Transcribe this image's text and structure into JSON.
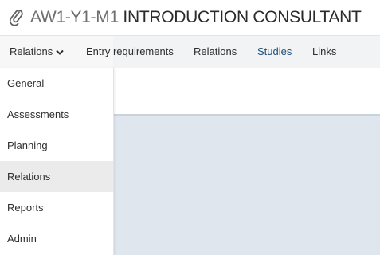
{
  "header": {
    "icon": "paperclip-icon",
    "code": "AW1-Y1-M1",
    "name": "INTRODUCTION CONSULTANT"
  },
  "tabs": {
    "dropdown_label": "Relations",
    "items": [
      {
        "label": "Entry requirements",
        "active": false
      },
      {
        "label": "Relations",
        "active": false
      },
      {
        "label": "Studies",
        "active": true
      },
      {
        "label": "Links",
        "active": false
      }
    ]
  },
  "menu": {
    "items": [
      {
        "label": "General",
        "selected": false
      },
      {
        "label": "Assessments",
        "selected": false
      },
      {
        "label": "Planning",
        "selected": false
      },
      {
        "label": "Relations",
        "selected": true
      },
      {
        "label": "Reports",
        "selected": false
      },
      {
        "label": "Admin",
        "selected": false
      }
    ]
  },
  "colors": {
    "active_tab": "#1d4f7a",
    "tab_bar_bg": "#f2f3f4",
    "panel_bg": "#dfe6ee",
    "selected_menu_bg": "#ebebeb"
  }
}
